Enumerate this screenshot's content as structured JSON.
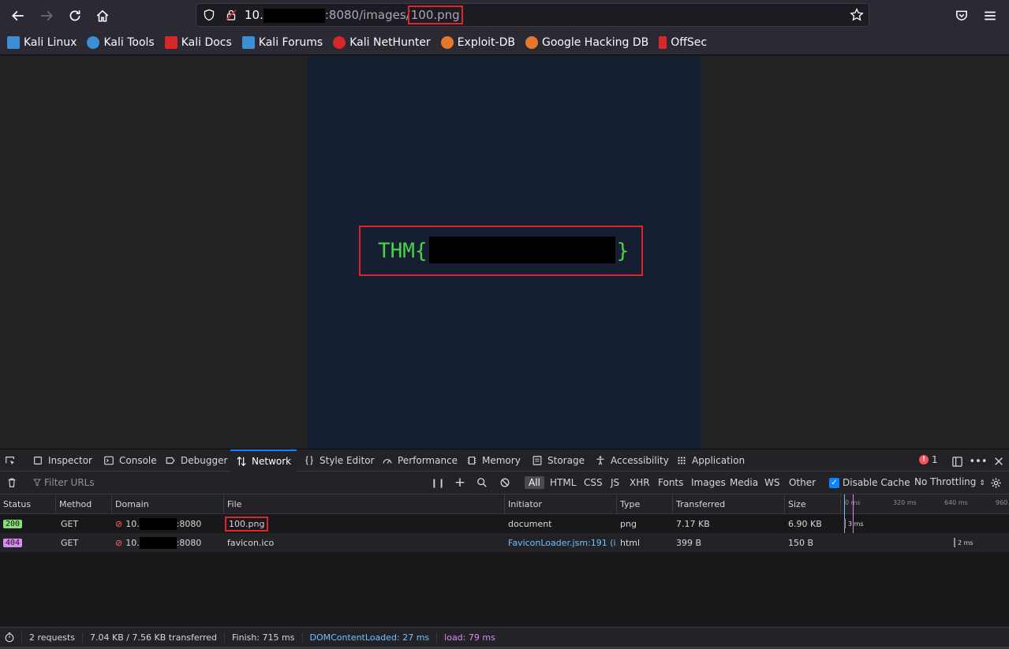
{
  "url": {
    "host_prefix": "10.",
    "port_path": ":8080/images/",
    "file": "100.png"
  },
  "bookmarks": [
    {
      "label": "Kali Linux",
      "color": "#3a8fd6"
    },
    {
      "label": "Kali Tools",
      "color": "#3a8fd6"
    },
    {
      "label": "Kali Docs",
      "color": "#d62828"
    },
    {
      "label": "Kali Forums",
      "color": "#3a8fd6"
    },
    {
      "label": "Kali NetHunter",
      "color": "#d62828"
    },
    {
      "label": "Exploit-DB",
      "color": "#e8772e"
    },
    {
      "label": "Google Hacking DB",
      "color": "#e8772e"
    },
    {
      "label": "OffSec",
      "color": "#d62828"
    }
  ],
  "flag": {
    "prefix": "THM{",
    "suffix": "}"
  },
  "devtools": {
    "tabs": [
      {
        "label": "Inspector",
        "icon": "inspector-icon"
      },
      {
        "label": "Console",
        "icon": "console-icon"
      },
      {
        "label": "Debugger",
        "icon": "debugger-icon"
      },
      {
        "label": "Network",
        "icon": "network-icon"
      },
      {
        "label": "Style Editor",
        "icon": "style-editor-icon"
      },
      {
        "label": "Performance",
        "icon": "performance-icon"
      },
      {
        "label": "Memory",
        "icon": "memory-icon"
      },
      {
        "label": "Storage",
        "icon": "storage-icon"
      },
      {
        "label": "Accessibility",
        "icon": "accessibility-icon"
      },
      {
        "label": "Application",
        "icon": "application-icon"
      }
    ],
    "active_tab": "Network",
    "error_count": "1"
  },
  "network_toolbar": {
    "filter_placeholder": "Filter URLs",
    "types": [
      "All",
      "HTML",
      "CSS",
      "JS",
      "XHR",
      "Fonts",
      "Images",
      "Media",
      "WS",
      "Other"
    ],
    "active_type": "All",
    "disable_cache_label": "Disable Cache",
    "disable_cache_checked": true,
    "throttling": "No Throttling"
  },
  "table": {
    "columns": [
      "Status",
      "Method",
      "Domain",
      "File",
      "Initiator",
      "Type",
      "Transferred",
      "Size"
    ],
    "waterfall_ticks": [
      "0 ms",
      "320 ms",
      "640 ms",
      "960"
    ],
    "rows": [
      {
        "status": "200",
        "status_color": "#86de74",
        "method": "GET",
        "domain_prefix": "10.",
        "domain_suffix": ":8080",
        "file": "100.png",
        "initiator": "document",
        "type": "png",
        "transferred": "7.17 KB",
        "size": "6.90 KB",
        "timing": "3 ms"
      },
      {
        "status": "404",
        "status_color": "#d88bf0",
        "method": "GET",
        "domain_prefix": "10.",
        "domain_suffix": ":8080",
        "file": "favicon.ico",
        "initiator": "FaviconLoader.jsm:191 (i...",
        "type": "html",
        "transferred": "399 B",
        "size": "150 B",
        "timing": "2 ms"
      }
    ]
  },
  "status_bar": {
    "requests": "2 requests",
    "transferred": "7.04 KB / 7.56 KB transferred",
    "finish": "Finish: 715 ms",
    "dom_loaded": "DOMContentLoaded: 27 ms",
    "load": "load: 79 ms",
    "dom_color": "#75bfff",
    "load_color": "#d88bf0"
  }
}
